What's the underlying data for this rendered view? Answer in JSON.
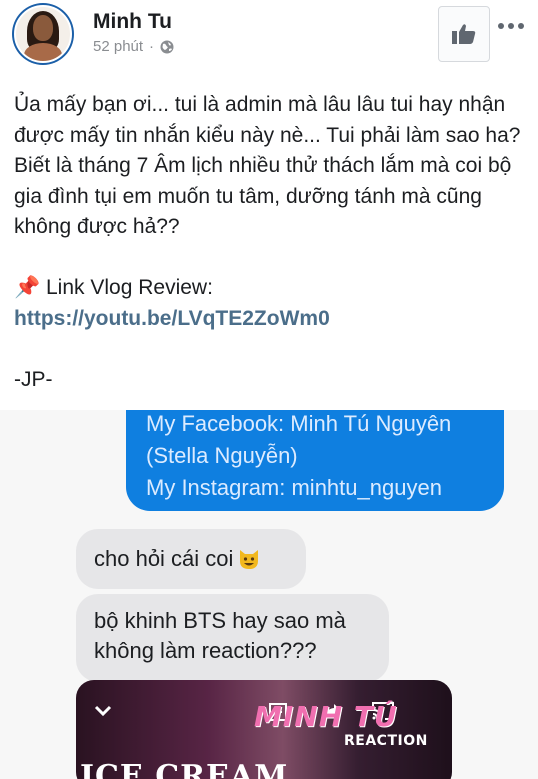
{
  "post": {
    "author": "Minh Tu",
    "time": "52 phút",
    "separator": "·",
    "paragraph_1": "Ủa mấy bạn ơi... tui là admin mà lâu lâu tui hay nhận được mấy tin nhắn kiểu này nè... Tui phải làm sao ha?",
    "paragraph_2": "Biết là tháng 7 Âm lịch nhiều thử thách lắm mà coi bộ gia đình tụi em muốn tu tâm, dưỡng tánh mà cũng không được hả??",
    "pin_emoji": "📌",
    "link_label": "Link Vlog Review:",
    "link_url": "https://youtu.be/LVqTE2ZoWm0",
    "signature": "-JP-"
  },
  "screenshot": {
    "sent_message": {
      "line_1": "My Facebook: Minh Tú Nguyên",
      "line_2": "(Stella Nguyễn)",
      "line_3": "My Instagram: minhtu_nguyen"
    },
    "received_1": "cho hỏi cái coi",
    "received_2": "bộ khinh BTS hay sao mà không làm reaction???",
    "video": {
      "title": "MINH TÚ",
      "subtitle": "REACTION",
      "caption": "ICE CREAM"
    }
  },
  "icons": {
    "privacy": "globe-icon",
    "like": "thumbs-up-icon",
    "more": "more-icon",
    "emoji": "grinning-cat-icon"
  },
  "colors": {
    "sent_bubble": "#0f7fe0",
    "received_bubble": "#e6e6e8",
    "link": "#4b6e8a",
    "avatar_ring": "#1b5fa8"
  }
}
